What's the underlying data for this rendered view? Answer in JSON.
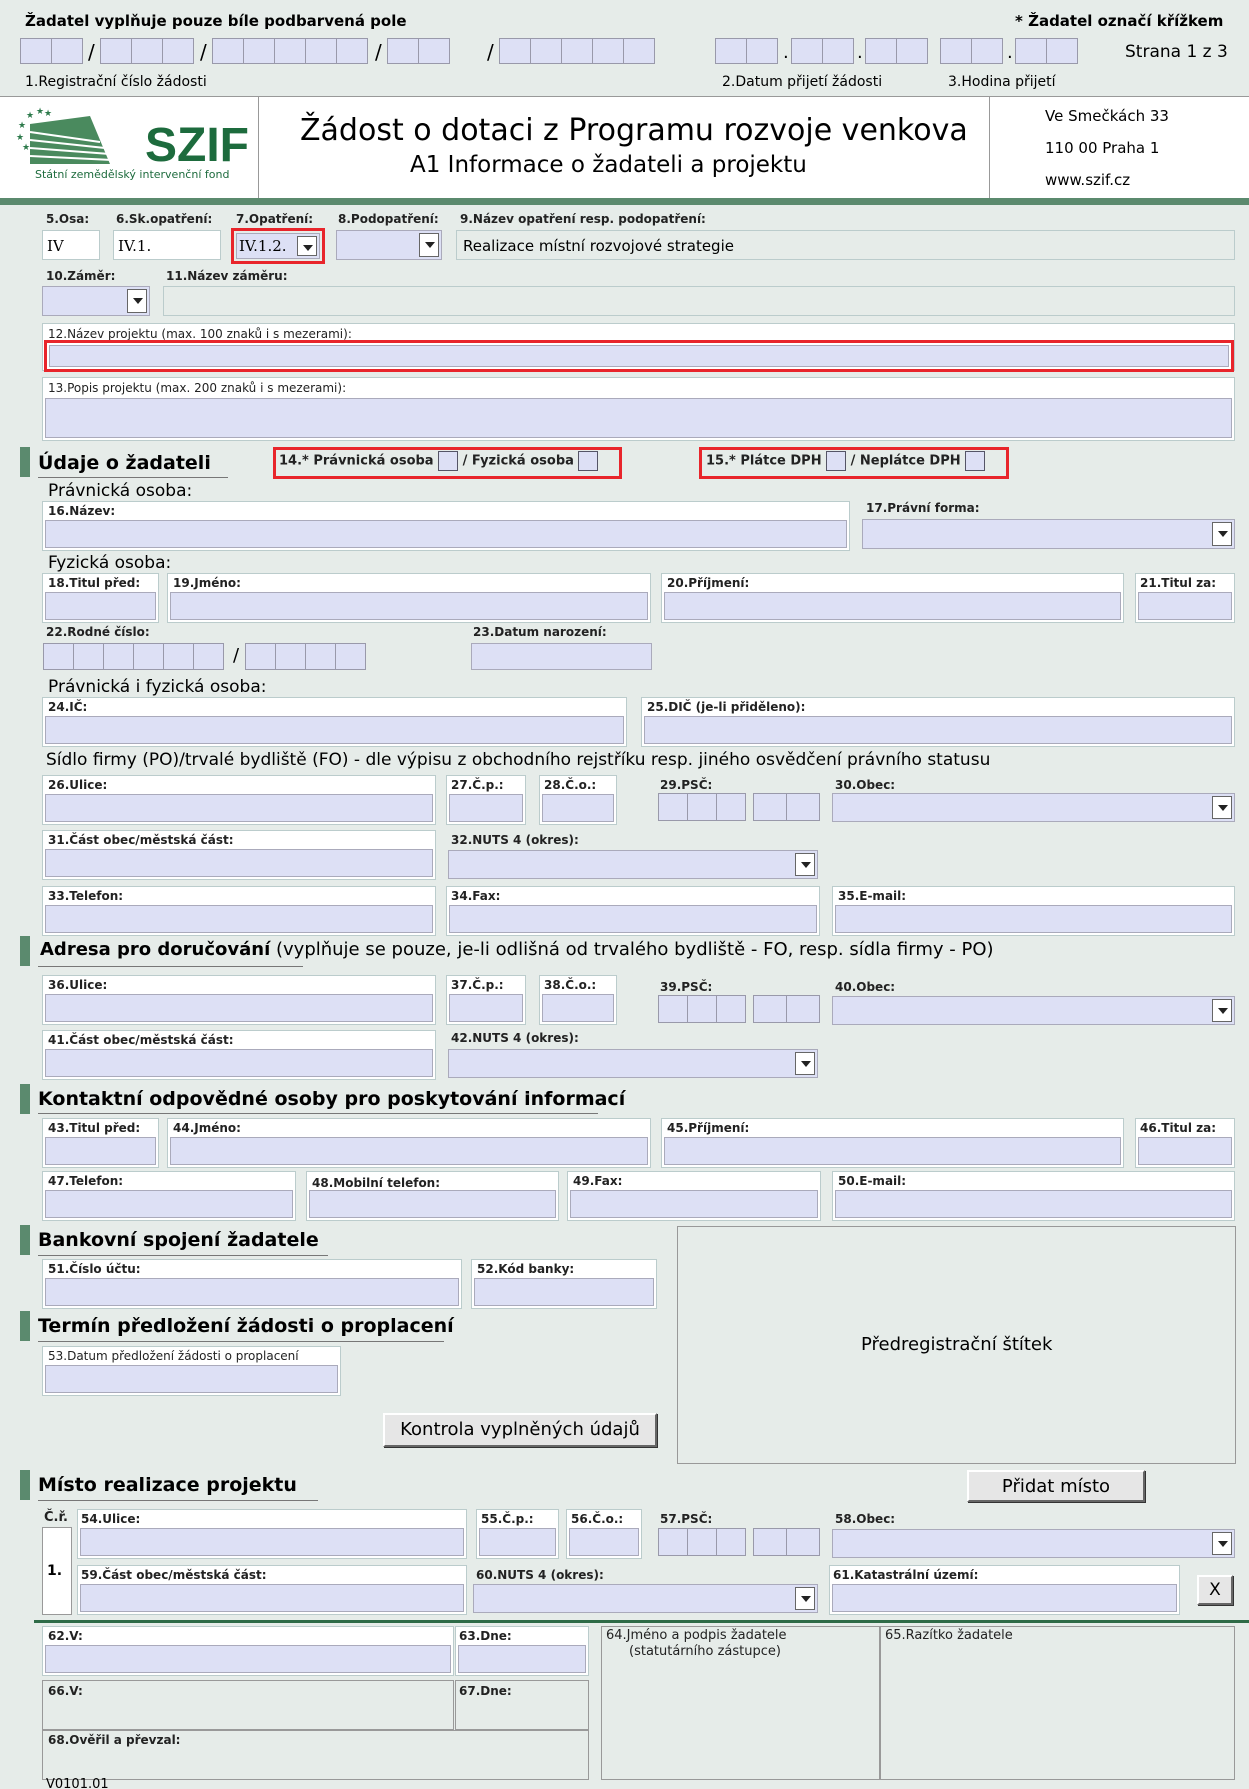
{
  "header": {
    "fill_note": "Žadatel vyplňuje pouze bíle podbarvená pole",
    "mark_note": "* Žadatel označí křížkem",
    "page_label": "Strana 1 z 3",
    "reg_label": "1.Registrační číslo žádosti",
    "date_label": "2.Datum přijetí žádosti",
    "time_label": "3.Hodina přijetí",
    "logo_text": "SZIF",
    "logo_sub": "Státní zemědělský intervenční fond",
    "title": "Žádost o dotaci z Programu rozvoje venkova",
    "subtitle": "A1 Informace o žadateli a projektu",
    "addr1": "Ve Smečkách 33",
    "addr2": "110 00 Praha 1",
    "addr3": "www.szif.cz"
  },
  "top": {
    "osa_label": "5.Osa:",
    "osa_value": "IV",
    "skop_label": "6.Sk.opatření:",
    "skop_value": "IV.1.",
    "opat_label": "7.Opatření:",
    "opat_value": "IV.1.2.",
    "podopat_label": "8.Podopatření:",
    "nazev_opat_label": "9.Název opatření resp. podopatření:",
    "nazev_opat_value": "Realizace místní rozvojové strategie",
    "zamer_label": "10.Záměr:",
    "nazev_zameru_label": "11.Název záměru:",
    "nazev_projektu_label": "12.Název projektu (max. 100 znaků i s mezerami):",
    "popis_label": "13.Popis projektu (max. 200 znaků i s mezerami):"
  },
  "zadatel": {
    "heading": "Údaje o žadateli",
    "f14_label": "14.* Právnická osoba",
    "f14_fo": "/ Fyzická osoba",
    "f15_label": "15.* Plátce DPH",
    "f15_neplatce": "/ Neplátce DPH",
    "po_heading": "Právnická osoba:",
    "nazev": "16.Název:",
    "pravni_forma": "17.Právní forma:",
    "fo_heading": "Fyzická osoba:",
    "titul_pred": "18.Titul před:",
    "jmeno": "19.Jméno:",
    "prijmeni": "20.Příjmení:",
    "titul_za": "21.Titul za:",
    "rodne_cislo": "22.Rodné číslo:",
    "datum_narozeni": "23.Datum narození:",
    "pofo_heading": "Právnická i fyzická osoba:",
    "ic": "24.IČ:",
    "dic": "25.DIČ (je-li přiděleno):",
    "sidlo_heading": "Sídlo firmy (PO)/trvalé bydliště (FO) - dle výpisu z obchodního rejstříku resp. jiného osvědčení právního statusu",
    "ulice": "26.Ulice:",
    "cp": "27.Č.p.:",
    "co": "28.Č.o.:",
    "psc": "29.PSČ:",
    "obec": "30.Obec:",
    "cast_obce": "31.Část obec/městská část:",
    "nuts": "32.NUTS 4 (okres):",
    "telefon": "33.Telefon:",
    "fax": "34.Fax:",
    "email": "35.E-mail:"
  },
  "dorucovani": {
    "heading_bold": "Adresa pro doručování",
    "heading_rest": " (vyplňuje se pouze, je-li odlišná od trvalého bydliště - FO, resp. sídla firmy - PO)",
    "ulice": "36.Ulice:",
    "cp": "37.Č.p.:",
    "co": "38.Č.o.:",
    "psc": "39.PSČ:",
    "obec": "40.Obec:",
    "cast_obce": "41.Část obec/městská část:",
    "nuts": "42.NUTS 4 (okres):"
  },
  "kontakt": {
    "heading": "Kontaktní odpovědné osoby pro poskytování informací",
    "titul_pred": "43.Titul před:",
    "jmeno": "44.Jméno:",
    "prijmeni": "45.Příjmení:",
    "titul_za": "46.Titul za:",
    "telefon": "47.Telefon:",
    "mobil": "48.Mobilní telefon:",
    "fax": "49.Fax:",
    "email": "50.E-mail:"
  },
  "banka": {
    "heading": "Bankovní spojení žadatele",
    "ucet": "51.Číslo účtu:",
    "kod": "52.Kód banky:"
  },
  "termin": {
    "heading": "Termín předložení žádosti o proplacení",
    "datum": "53.Datum předložení žádosti o proplacení",
    "kontrola_btn": "Kontrola vyplněných údajů"
  },
  "stitek": "Předregistrační štítek",
  "misto": {
    "heading": "Místo realizace projektu",
    "pridat_btn": "Přidat místo",
    "cr": "Č.ř.",
    "row_no": "1.",
    "ulice": "54.Ulice:",
    "cp": "55.Č.p.:",
    "co": "56.Č.o.:",
    "psc": "57.PSČ:",
    "obec": "58.Obec:",
    "cast_obce": "59.Část obec/městská část:",
    "nuts": "60.NUTS 4 (okres):",
    "katastr": "61.Katastrální území:",
    "delete_btn": "X"
  },
  "podpis": {
    "v1": "62.V:",
    "dne1": "63.Dne:",
    "jmeno": "64.Jméno a podpis žadatele",
    "jmeno2": "(statutárního zástupce)",
    "razitko": "65.Razítko žadatele",
    "v2": "66.V:",
    "dne2": "67.Dne:",
    "overil": "68.Ověřil a převzal:"
  },
  "footer_code": "V0101.01",
  "colors": {
    "accent": "#5b8a6e",
    "highlight": "#e8252b",
    "field": "#dde0f5",
    "page": "#e6ece9"
  }
}
